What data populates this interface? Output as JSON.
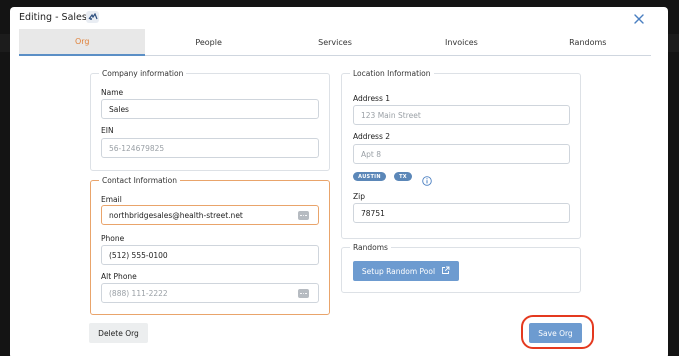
{
  "modal": {
    "title": "Editing - Sales",
    "logo_icon": "org-logo-icon",
    "close_icon": "close-icon"
  },
  "tabs": [
    {
      "label": "Org",
      "active": true
    },
    {
      "label": "People",
      "active": false
    },
    {
      "label": "Services",
      "active": false
    },
    {
      "label": "Invoices",
      "active": false
    },
    {
      "label": "Randoms",
      "active": false
    }
  ],
  "company": {
    "legend": "Company information",
    "name_label": "Name",
    "name_value": "Sales",
    "ein_label": "EIN",
    "ein_placeholder": "56-124679825"
  },
  "contact": {
    "legend": "Contact Information",
    "email_label": "Email",
    "email_value": "northbridgesales@health-street.net",
    "phone_label": "Phone",
    "phone_value": "(512) 555-0100",
    "alt_phone_label": "Alt Phone",
    "alt_phone_placeholder": "(888) 111-2222"
  },
  "location": {
    "legend": "Location Information",
    "address1_label": "Address 1",
    "address1_placeholder": "123 Main Street",
    "address2_label": "Address 2",
    "address2_placeholder": "Apt 8",
    "city_chip": "AUSTIN",
    "state_chip": "TX",
    "zip_label": "Zip",
    "zip_value": "78751"
  },
  "randoms": {
    "legend": "Randoms",
    "setup_button": "Setup Random Pool"
  },
  "actions": {
    "delete_button": "Delete Org",
    "save_button": "Save Org"
  },
  "colors": {
    "accent_orange": "#e0823b",
    "primary_blue": "#6d9bd0",
    "highlight_red": "#e4391f"
  }
}
